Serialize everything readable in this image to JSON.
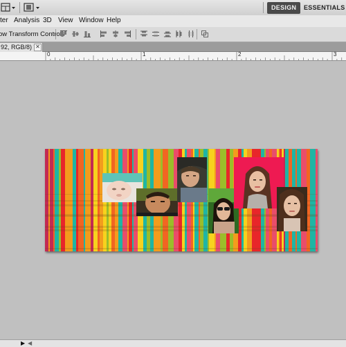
{
  "app_bar": {
    "tools": [
      {
        "icon": "arrange-documents-icon"
      },
      {
        "icon": "screen-mode-icon"
      }
    ],
    "workspaces": {
      "active": "DESIGN",
      "other": "ESSENTIALS"
    }
  },
  "menu": {
    "items": [
      "ter",
      "Analysis",
      "3D",
      "View",
      "Window",
      "Help"
    ]
  },
  "options_bar": {
    "transform_controls_label": "ow Transform Controls",
    "align_icons": [
      "align-top-edges-icon",
      "align-vertical-centers-icon",
      "align-bottom-edges-icon",
      "align-left-edges-icon",
      "align-horizontal-centers-icon",
      "align-right-edges-icon"
    ],
    "distribute_icons": [
      "distribute-top-icon",
      "distribute-vertical-centers-icon",
      "distribute-bottom-icon",
      "distribute-left-icon",
      "distribute-horizontal-centers-icon",
      "distribute-right-icon"
    ],
    "auto_align_icon": "auto-align-layers-icon"
  },
  "document": {
    "tab_title": "92, RGB/8) *",
    "close_glyph": "✕"
  },
  "ruler": {
    "labels": [
      "0",
      "1",
      "2",
      "3"
    ]
  },
  "artwork": {
    "photos": [
      {
        "name": "baby-photo"
      },
      {
        "name": "boy-photo"
      },
      {
        "name": "girl-hat-photo"
      },
      {
        "name": "woman-sunglasses-photo"
      },
      {
        "name": "woman-red-background-photo"
      },
      {
        "name": "woman-brown-hair-photo"
      }
    ],
    "stripe_palette": [
      "#e8262a",
      "#f39c1d",
      "#f7d21e",
      "#1fb5a4",
      "#c22a53",
      "#e94d6a",
      "#9bbd2a",
      "#f26522"
    ]
  },
  "bottom": {
    "arrow_glyph": "▶",
    "left_arrow_glyph": "◀"
  }
}
